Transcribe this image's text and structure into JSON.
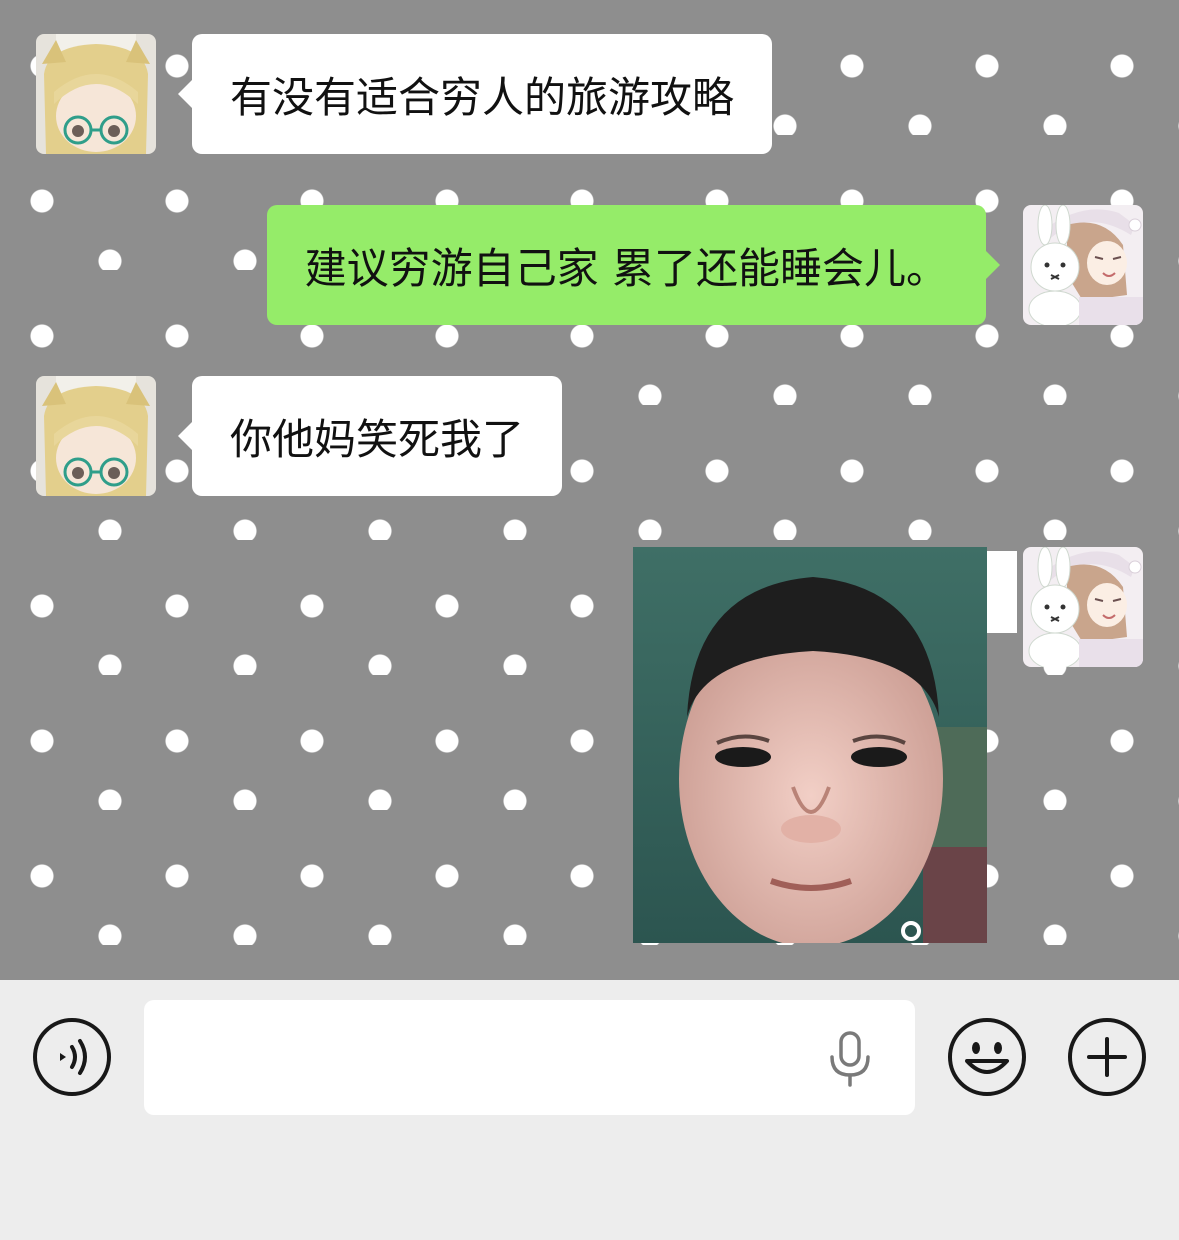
{
  "messages": [
    {
      "sender": "other",
      "type": "text",
      "text": "有没有适合穷人的旅游攻略"
    },
    {
      "sender": "self",
      "type": "text",
      "text": "建议穷游自己家 累了还能睡会儿。"
    },
    {
      "sender": "other",
      "type": "text",
      "text": "你他妈笑死我了"
    },
    {
      "sender": "self",
      "type": "image",
      "image": "child-face-meme-photo"
    }
  ],
  "avatars": {
    "other": "blonde-anime-girl-with-glasses-avatar",
    "self": "anime-girl-with-bunny-plush-avatar"
  },
  "input_bar": {
    "voice_icon": "voice-mode-icon",
    "text_value": "",
    "mic_icon": "microphone-icon",
    "emoji_icon": "emoji-icon",
    "more_icon": "plus-icon"
  },
  "colors": {
    "chat_background": "#8e8e8e",
    "polka_dot": "#ffffff",
    "incoming_bubble": "#ffffff",
    "outgoing_bubble": "#95ec69",
    "input_bar_background": "#ededed"
  }
}
